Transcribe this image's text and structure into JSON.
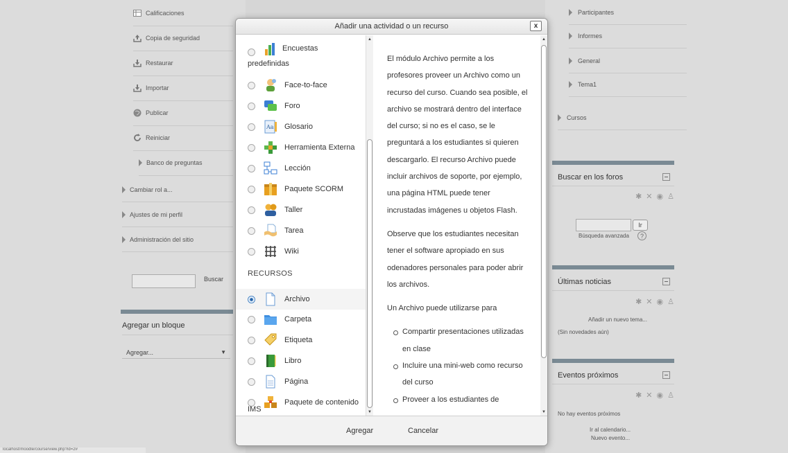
{
  "left": {
    "admin_items": [
      {
        "label": "Calificaciones",
        "icon": "grades-icon"
      },
      {
        "label": "Copia de seguridad",
        "icon": "backup-icon"
      },
      {
        "label": "Restaurar",
        "icon": "restore-icon"
      },
      {
        "label": "Importar",
        "icon": "import-icon"
      },
      {
        "label": "Publicar",
        "icon": "publish-icon"
      },
      {
        "label": "Reiniciar",
        "icon": "reset-icon"
      }
    ],
    "question_bank": "Banco de preguntas",
    "tree_items": [
      "Cambiar rol a...",
      "Ajustes de mi perfil",
      "Administración del sitio"
    ],
    "search_button": "Buscar",
    "add_block_title": "Agregar un bloque",
    "add_block_select": "Agregar..."
  },
  "modal": {
    "title": "Añadir una actividad o un recurso",
    "close": "x",
    "activities": [
      {
        "label": "Encuestas predefinidas",
        "icon": "survey-icon"
      },
      {
        "label": "Face-to-face",
        "icon": "face-to-face-icon"
      },
      {
        "label": "Foro",
        "icon": "forum-icon"
      },
      {
        "label": "Glosario",
        "icon": "glossary-icon"
      },
      {
        "label": "Herramienta Externa",
        "icon": "external-tool-icon"
      },
      {
        "label": "Lección",
        "icon": "lesson-icon"
      },
      {
        "label": "Paquete SCORM",
        "icon": "scorm-icon"
      },
      {
        "label": "Taller",
        "icon": "workshop-icon"
      },
      {
        "label": "Tarea",
        "icon": "assignment-icon"
      },
      {
        "label": "Wiki",
        "icon": "wiki-icon"
      }
    ],
    "resources_heading": "RECURSOS",
    "resources": [
      {
        "label": "Archivo",
        "icon": "file-icon",
        "selected": true
      },
      {
        "label": "Carpeta",
        "icon": "folder-icon"
      },
      {
        "label": "Etiqueta",
        "icon": "label-icon"
      },
      {
        "label": "Libro",
        "icon": "book-icon"
      },
      {
        "label": "Página",
        "icon": "page-icon"
      },
      {
        "label": "Paquete de contenido IMS",
        "icon": "ims-package-icon"
      }
    ],
    "description": {
      "p1": "El módulo Archivo permite a los profesores proveer un Archivo como un recurso del curso. Cuando sea posible, el archivo se mostrará dentro del interface del curso; si no es el caso, se le preguntará a los estudiantes si quieren descargarlo. El recurso Archivo puede incluir archivos de soporte, por ejemplo, una página HTML puede tener incrustadas imágenes u objetos Flash.",
      "p2": "Observe que los estudiantes necesitan tener el software apropiado en sus odenadores personales para poder abrir los archivos.",
      "p3": "Un Archivo puede utilizarse para",
      "bullets": [
        "Compartir presentaciones utilizadas en clase",
        "Incluire una mini-web como recurso del curso",
        "Proveer a los estudiantes de borradores de archivos para que los"
      ]
    },
    "add_button": "Agregar",
    "cancel_button": "Cancelar"
  },
  "right": {
    "nav": [
      "Participantes",
      "Informes",
      "General",
      "Tema1"
    ],
    "courses": "Cursos",
    "forum_search_title": "Buscar en los foros",
    "go_button": "Ir",
    "advanced_search": "Búsqueda avanzada",
    "news_title": "Últimas noticias",
    "add_topic": "Añadir un nuevo tema...",
    "no_news": "(Sin novedades aún)",
    "events_title": "Eventos próximos",
    "no_events": "No hay eventos próximos",
    "calendar_link": "Ir al calendario...",
    "new_event": "Nuevo evento..."
  },
  "statusbar": "localhost/moodle/course/view.php?id=2#"
}
